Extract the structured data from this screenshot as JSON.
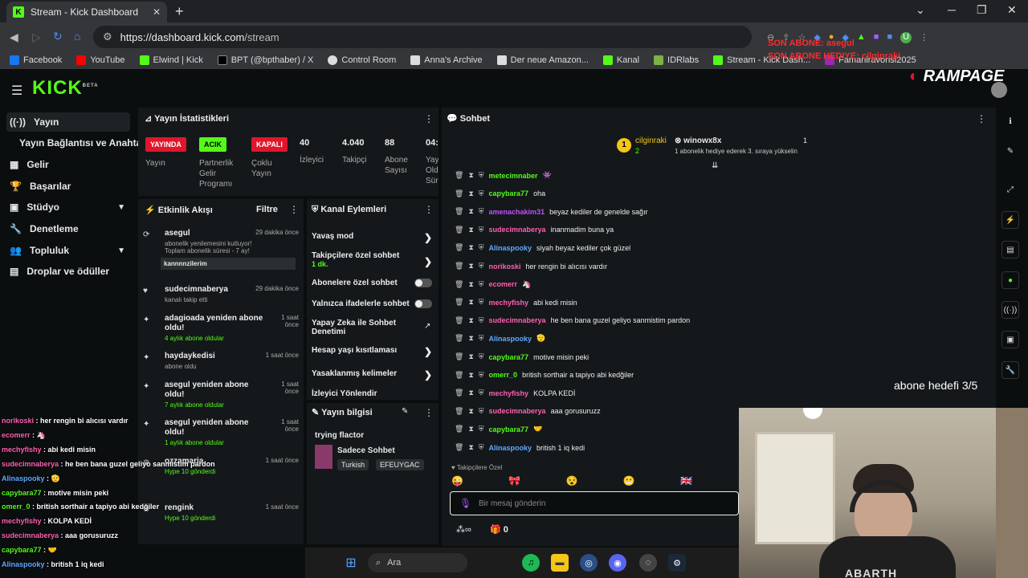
{
  "browser": {
    "tab_title": "Stream - Kick Dashboard",
    "url_host": "https://dashboard.kick.com",
    "url_path": "/stream",
    "bookmarks": [
      {
        "label": "Facebook",
        "color": "#1877f2"
      },
      {
        "label": "YouTube",
        "color": "#ff0000"
      },
      {
        "label": "Elwind | Kick",
        "color": "#53fc18"
      },
      {
        "label": "BPT (@bpthaber) / X",
        "color": "#000000"
      },
      {
        "label": "Control Room",
        "color": "#ffffff"
      },
      {
        "label": "Anna's Archive",
        "color": "#ffffff"
      },
      {
        "label": "Der neue Amazon...",
        "color": "#ffffff"
      },
      {
        "label": "Kanal",
        "color": "#53fc18"
      },
      {
        "label": "IDRlabs",
        "color": "#7cb342"
      },
      {
        "label": "Stream - Kick Dash...",
        "color": "#53fc18"
      },
      {
        "label": "Famaniravorisi2025",
        "color": "#9c27b0"
      }
    ]
  },
  "overlay": {
    "sub_alert_1": "SON ABONE: asegul",
    "sub_alert_2": "SON ABONE HEDIYE: cilginraki",
    "brand": "RAMPAGE",
    "sub_goal": "abone hedefi 3/5"
  },
  "kick": {
    "logo": "KICK",
    "beta": "BETA"
  },
  "sidebar": {
    "items": [
      {
        "label": "Yayın",
        "icon": "broadcast-icon"
      },
      {
        "label": "Yayın Bağlantısı ve Anahtarı",
        "icon": ""
      },
      {
        "label": "Gelir",
        "icon": "revenue-icon"
      },
      {
        "label": "Başarılar",
        "icon": "trophy-icon"
      },
      {
        "label": "Stüdyo",
        "icon": "studio-icon"
      },
      {
        "label": "Denetleme",
        "icon": "wrench-icon"
      },
      {
        "label": "Topluluk",
        "icon": "community-icon"
      },
      {
        "label": "Droplar ve ödüller",
        "icon": "drops-icon"
      }
    ]
  },
  "stats": {
    "title": "Yayın İstatistikleri",
    "badges": [
      {
        "label": "YAYINDA",
        "color": "#e0162b",
        "caption": "Yayın"
      },
      {
        "label": "ACIK",
        "color": "#53fc18",
        "caption": "Partnerlik Gelir Programı"
      },
      {
        "label": "KAPALI",
        "color": "#e0162b",
        "caption": "Çoklu Yayın"
      }
    ],
    "values": [
      {
        "value": "40",
        "caption": "İzleyici"
      },
      {
        "value": "4.040",
        "caption": "Takipçi"
      },
      {
        "value": "88",
        "caption": "Abone Sayısı"
      },
      {
        "value": "04:",
        "caption": "Yay Old Sür"
      }
    ]
  },
  "activity": {
    "title": "Etkinlik Akışı",
    "filter": "Filtre",
    "items": [
      {
        "name": "asegul",
        "sub": "abonelik yenilemesini kutluyor! Toplam abonelik süresi - 7 ay!",
        "time": "29 dakika önce",
        "msg": "kannnnzilerim"
      },
      {
        "name": "sudecimnaberya",
        "sub": "kanalı takip etti",
        "time": "29 dakika önce"
      },
      {
        "name": "adagioada yeniden abone oldu!",
        "sub": "4 aylık abone oldular",
        "time": "1 saat önce"
      },
      {
        "name": "haydaykedisi",
        "sub": "abone oldu",
        "time": "1 saat önce"
      },
      {
        "name": "asegul yeniden abone oldu!",
        "sub": "7 aylık abone oldular",
        "time": "1 saat önce"
      },
      {
        "name": "asegul yeniden abone oldu!",
        "sub": "1 aylık abone oldular",
        "time": "1 saat önce"
      },
      {
        "name": "ozzamaria",
        "sub": "Hype 10 gönderdi",
        "time": "1 saat önce"
      },
      {
        "name": "rengink",
        "sub": "Hype 10 gönderdi",
        "time": "1 saat önce"
      }
    ]
  },
  "channel_actions": {
    "title": "Kanal Eylemleri",
    "items": [
      {
        "label": "Yavaş mod",
        "type": "arrow"
      },
      {
        "label": "Takipçilere özel sohbet",
        "sub": "1 dk.",
        "type": "arrow"
      },
      {
        "label": "Abonelere özel sohbet",
        "type": "toggle"
      },
      {
        "label": "Yalnızca ifadelerle sohbet",
        "type": "toggle"
      },
      {
        "label": "Yapay Zeka ile Sohbet Denetimi",
        "type": "link"
      },
      {
        "label": "Hesap yaşı kısıtlaması",
        "type": "arrow"
      },
      {
        "label": "Yasaklanmış kelimeler",
        "type": "arrow"
      },
      {
        "label": "İzleyici Yönlendir",
        "type": "none"
      }
    ]
  },
  "stream_info": {
    "title": "Yayın bilgisi",
    "stream_title": "trying flactor",
    "category": "Sadece Sohbet",
    "tags": [
      "Turkish",
      "EFEUYGAC"
    ]
  },
  "chat": {
    "title": "Sohbet",
    "pinned": {
      "user": "cilginraki",
      "count": "2",
      "target": "winowx8x",
      "text": "1 abonelik hediye ederek 3. sıraya yükselin",
      "badge": "1"
    },
    "messages": [
      {
        "user": "metecimnaber",
        "color": "#53fc18",
        "text": "👾"
      },
      {
        "user": "capybara77",
        "color": "#53fc18",
        "text": "oha"
      },
      {
        "user": "amenachakim31",
        "color": "#c050ff",
        "text": "beyaz kediler de genelde sağır"
      },
      {
        "user": "sudecimnaberya",
        "color": "#ff5fb0",
        "text": "inanmadim buna ya"
      },
      {
        "user": "Alinaspooky",
        "color": "#5fa8ff",
        "text": "siyah beyaz kediler çok güzel"
      },
      {
        "user": "norikoski",
        "color": "#ff5fb0",
        "text": "her rengin bi alıcısı vardır"
      },
      {
        "user": "ecomerr",
        "color": "#ff5fb0",
        "text": "🦄"
      },
      {
        "user": "mechyfishy",
        "color": "#ff5fb0",
        "text": "abi kedi misin"
      },
      {
        "user": "sudecimnaberya",
        "color": "#ff5fb0",
        "text": "he ben bana guzel geliyo sanmistim pardon"
      },
      {
        "user": "Alinaspooky",
        "color": "#5fa8ff",
        "text": "🫡"
      },
      {
        "user": "capybara77",
        "color": "#53fc18",
        "text": "motive misin peki"
      },
      {
        "user": "omerr_0",
        "color": "#53fc18",
        "text": "british sorthair a tapiyo abi kedğiler"
      },
      {
        "user": "mechyfishy",
        "color": "#ff5fb0",
        "text": "KOLPA KEDİ"
      },
      {
        "user": "sudecimnaberya",
        "color": "#ff5fb0",
        "text": "aaa gorusuruzz"
      },
      {
        "user": "capybara77",
        "color": "#53fc18",
        "text": "🤝"
      },
      {
        "user": "Alinaspooky",
        "color": "#5fa8ff",
        "text": "british 1 iq kedi"
      }
    ],
    "follower_only": "Takipçilere Özel",
    "input_placeholder": "Bir mesaj gönderin",
    "footer_count": "0"
  },
  "overlay_chat": [
    {
      "user": "norikoski",
      "color": "#ff5fb0",
      "text": "her rengin bi alıcısı vardır"
    },
    {
      "user": "ecomerr",
      "color": "#ff5fb0",
      "text": "🦄"
    },
    {
      "user": "mechyfishy",
      "color": "#ff5fb0",
      "text": "abi kedi misin"
    },
    {
      "user": "sudecimnaberya",
      "color": "#ff5fb0",
      "text": "he ben bana guzel geliyo sanmistim pardon"
    },
    {
      "user": "Alinaspooky",
      "color": "#5fa8ff",
      "text": "🫡"
    },
    {
      "user": "capybara77",
      "color": "#53fc18",
      "text": "motive misin peki"
    },
    {
      "user": "omerr_0",
      "color": "#53fc18",
      "text": "british sorthair a tapiyo abi kedğiler"
    },
    {
      "user": "mechyfishy",
      "color": "#ff5fb0",
      "text": "KOLPA KEDİ"
    },
    {
      "user": "sudecimnaberya",
      "color": "#ff5fb0",
      "text": "aaa gorusuruzz"
    },
    {
      "user": "capybara77",
      "color": "#53fc18",
      "text": "🤝"
    },
    {
      "user": "Alinaspooky",
      "color": "#5fa8ff",
      "text": "british 1 iq kedi"
    }
  ],
  "taskbar": {
    "search": "Ara"
  },
  "webcam": {
    "shirt_text": "ABARTH"
  }
}
